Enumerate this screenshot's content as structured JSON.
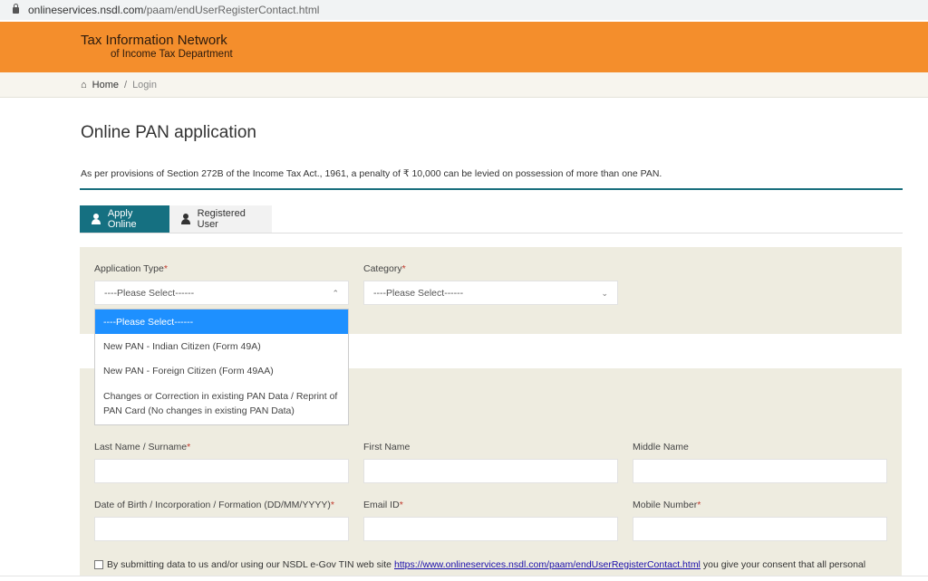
{
  "browser": {
    "url_host": "onlineservices.nsdl.com",
    "url_path": "/paam/endUserRegisterContact.html"
  },
  "header": {
    "line1": "Tax Information Network",
    "line2": "of Income Tax Department",
    "bg": "#f48e2c"
  },
  "breadcrumb": {
    "home": "Home",
    "sep": "/",
    "current": "Login"
  },
  "page": {
    "title": "Online PAN application",
    "notice": "As per provisions of Section 272B of the Income Tax Act., 1961, a penalty of ₹ 10,000 can be levied on possession of more than one PAN."
  },
  "tabs": [
    {
      "label": "Apply Online",
      "icon": "user-plus-icon",
      "active": true
    },
    {
      "label": "Registered User",
      "icon": "user-icon",
      "active": false
    }
  ],
  "form": {
    "application_type": {
      "label": "Application Type",
      "value": "----Please Select------",
      "expanded": true,
      "options": [
        "----Please Select------",
        "New PAN - Indian Citizen (Form 49A)",
        "New PAN - Foreign Citizen (Form 49AA)",
        "Changes or Correction in existing PAN Data / Reprint of PAN Card (No changes in existing PAN Data)"
      ]
    },
    "category": {
      "label": "Category",
      "value": "----Please Select------"
    },
    "required_mark": "*",
    "last_name": {
      "label": "Last Name / Surname",
      "value": ""
    },
    "first_name": {
      "label": "First Name",
      "value": ""
    },
    "middle_name": {
      "label": "Middle Name",
      "value": ""
    },
    "dob": {
      "label": "Date of Birth / Incorporation / Formation (DD/MM/YYYY)",
      "value": ""
    },
    "email": {
      "label": "Email ID",
      "value": ""
    },
    "mobile": {
      "label": "Mobile Number",
      "value": ""
    },
    "consent": {
      "before": "By submitting data to us and/or using our NSDL e-Gov TIN web site",
      "link": "https://www.onlineservices.nsdl.com/paam/endUserRegisterContact.html",
      "after": "you give your consent that all personal",
      "checked": false
    }
  },
  "colors": {
    "accent": "#157081",
    "panel": "#eeece0",
    "highlight": "#1e90ff"
  }
}
